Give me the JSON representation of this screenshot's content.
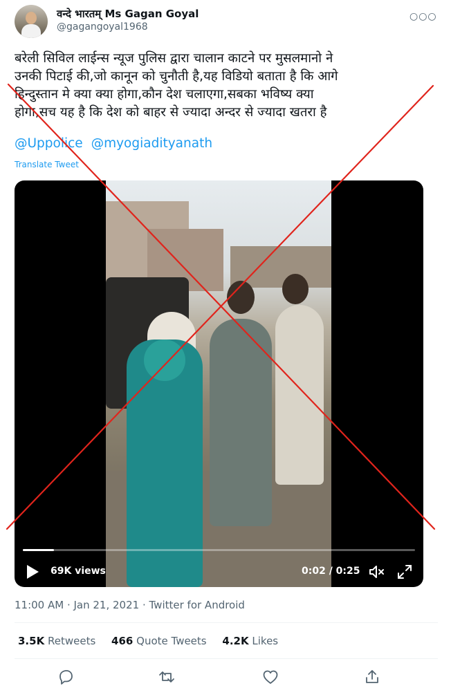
{
  "author": {
    "display_name": "वन्दे भारतम् Ms Gagan Goyal",
    "handle": "@gagangoyal1968"
  },
  "more_icon": "more-horizontal-icon",
  "tweet": {
    "text_lines": [
      "बरेली सिविल लाईन्स न्यूज पुलिस द्वारा चालान काटने पर मुसलमानो ने",
      "उनकी पिटाई की,जो कानून को चुनौती है,यह विडियो बताता है कि आगे",
      "हिन्दुस्तान मे क्या क्या होगा,कौन देश चलाएगा,सबका भविष्य क्या",
      "होगा,सच यह है कि देश को बाहर से ज्यादा अन्दर से ज्यादा खतरा है"
    ],
    "mentions": [
      "@Uppolice",
      "@myogiadityanath"
    ],
    "translate_label": "Translate Tweet"
  },
  "video": {
    "views": "69K views",
    "time": "0:02 / 0:25",
    "progress_fraction": 0.08,
    "overlay_color": "#e0241c"
  },
  "meta": {
    "timestamp": "11:00 AM · Jan 21, 2021 · Twitter for Android"
  },
  "stats": [
    {
      "count": "3.5K",
      "label": "Retweets"
    },
    {
      "count": "466",
      "label": "Quote Tweets"
    },
    {
      "count": "4.2K",
      "label": "Likes"
    }
  ],
  "actions": [
    "reply-icon",
    "retweet-icon",
    "like-icon",
    "share-icon"
  ],
  "colors": {
    "link": "#1d9bf0",
    "muted": "#536471",
    "text": "#0f1419"
  }
}
